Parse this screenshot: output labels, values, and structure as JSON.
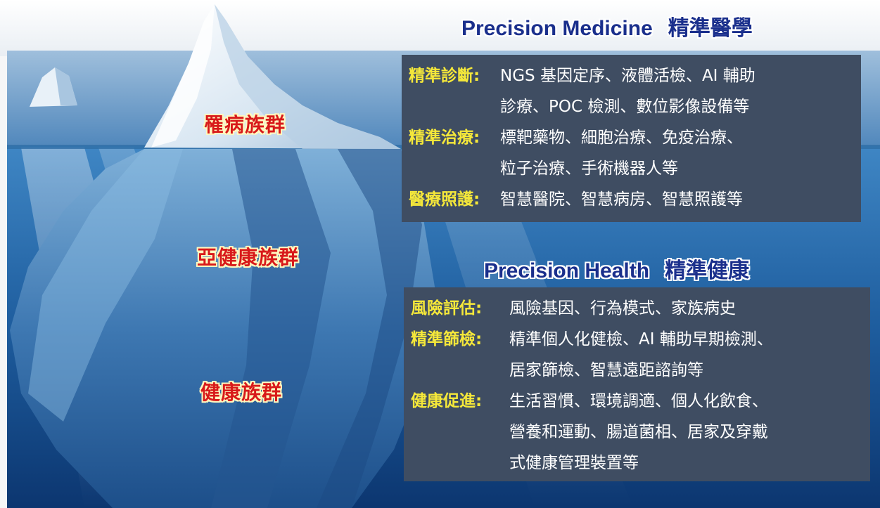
{
  "groups": {
    "rare": "罹病族群",
    "sub_health": "亞健康族群",
    "healthy": "健康族群"
  },
  "medicine": {
    "title_en": "Precision Medicine",
    "title_zh": "精準醫學",
    "rows": [
      {
        "label": "精準診斷:",
        "lines": [
          "NGS 基因定序、液體活檢、AI 輔助",
          "診療、POC 檢測、數位影像設備等"
        ]
      },
      {
        "label": "精準治療:",
        "lines": [
          "標靶藥物、細胞治療、免疫治療、",
          "粒子治療、手術機器人等"
        ]
      },
      {
        "label": "醫療照護:",
        "lines": [
          "智慧醫院、智慧病房、智慧照護等"
        ]
      }
    ]
  },
  "health": {
    "title_en": "Precision Health",
    "title_zh": "精準健康",
    "rows": [
      {
        "label": "風險評估:",
        "lines": [
          "風險基因、行為模式、家族病史"
        ]
      },
      {
        "label": "精準篩檢:",
        "lines": [
          "精準個人化健檢、AI 輔助早期檢測、",
          "居家篩檢、智慧遠距諮詢等"
        ]
      },
      {
        "label": "健康促進:",
        "lines": [
          "生活習慣、環境調適、個人化飲食、",
          "營養和運動、腸道菌相、居家及穿戴",
          "式健康管理裝置等"
        ]
      }
    ]
  },
  "colors": {
    "title": "#1a2f8c",
    "group_label": "#d8191a",
    "box_bg": "#3f4d62",
    "box_label": "#f5e83a",
    "sea_top": "#7fa9cf",
    "sea_deep": "#0f3f78"
  }
}
